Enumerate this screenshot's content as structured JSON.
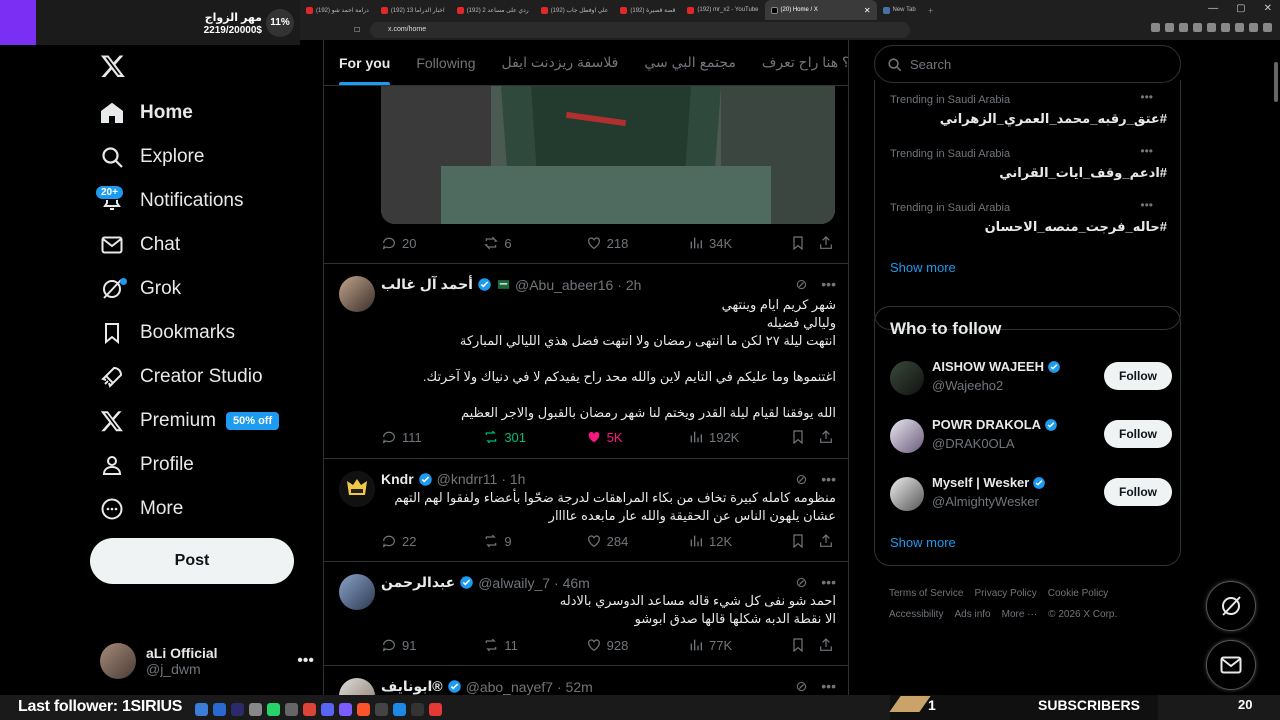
{
  "browser": {
    "tabs": [
      {
        "label": "(192) درامة احمد شو"
      },
      {
        "label": "(192) اخبار الدراما 13"
      },
      {
        "label": "(192) ردي على مساعد 2"
      },
      {
        "label": "(192) علي اوفطل جاب"
      },
      {
        "label": "(192) قصة قصيرة"
      },
      {
        "label": "(192) mr_x2 - YouTube"
      },
      {
        "label": "(20) Home / X"
      },
      {
        "label": "New Tab"
      }
    ],
    "url": "x.com/home"
  },
  "overlay": {
    "goal_title": "مهر الزواج",
    "goal_progress": "2219/20000$",
    "goal_percent": "11%",
    "last_follower": "Last follower: 1SIRIUS",
    "subscribers_count": "1",
    "subscribers_label": "SUBSCRIBERS",
    "corner_number": "20"
  },
  "sidebar": {
    "items": [
      {
        "label": "Home",
        "icon": "home-icon"
      },
      {
        "label": "Explore",
        "icon": "search-icon"
      },
      {
        "label": "Notifications",
        "icon": "bell-icon"
      },
      {
        "label": "Chat",
        "icon": "mail-icon"
      },
      {
        "label": "Grok",
        "icon": "grok-icon"
      },
      {
        "label": "Bookmarks",
        "icon": "bookmark-icon"
      },
      {
        "label": "Creator Studio",
        "icon": "rocket-icon"
      },
      {
        "label": "Premium",
        "icon": "x-icon"
      },
      {
        "label": "Profile",
        "icon": "person-icon"
      },
      {
        "label": "More",
        "icon": "more-circle-icon"
      }
    ],
    "notifications_badge": "20+",
    "premium_badge": "50% off",
    "post_label": "Post",
    "account_name": "aLi Official",
    "account_handle": "@j_dwm"
  },
  "feed": {
    "tabs": [
      "For you",
      "Following",
      "فلاسفة ريزدنت ايفل",
      "مجتمع البي سي",
      "فضل ؟ هنا راح تعرف"
    ],
    "first_actions": {
      "replies": "20",
      "reposts": "6",
      "likes": "218",
      "views": "34K"
    },
    "tweets": [
      {
        "name": "أحمد آل غالب",
        "handle": "@Abu_abeer16",
        "time": "· 2h",
        "text": "شهر كريم ايام وينتهي\nوليالي فضيله\nانتهت ليلة ٢٧ لكن ما انتهى رمضان ولا انتهت فضل هذي الليالي المباركة\n\nاغتنموها وما عليكم في التايم لاين والله محد راح يفيدكم لا في دنياك ولا آخرتك.\n\nالله يوفقنا لقيام ليلة القدر ويختم لنا شهر رمضان بالقبول والاجر العظيم",
        "replies": "111",
        "reposts": "301",
        "likes": "5K",
        "views": "192K"
      },
      {
        "name": "Kndr",
        "handle": "@kndrr11",
        "time": "· 1h",
        "text": "منظومه كامله كبيرة تخاف من بكاء المراهقات لدرجة ضحّوا بأعضاء ولفقوا لهم التهم\nعشان يلهون الناس عن الحقيقة والله عار مابعده عاااار",
        "replies": "22",
        "reposts": "9",
        "likes": "284",
        "views": "12K"
      },
      {
        "name": "عبدالرحمن",
        "handle": "@alwaily_7",
        "time": "· 46m",
        "text": "احمد شو نفى كل شيء قاله مساعد الدوسري بالادله\nالا نقطة الدبه شكلها قالها صدق ابوشو",
        "replies": "91",
        "reposts": "11",
        "likes": "928",
        "views": "77K"
      },
      {
        "name": "ابونايف®",
        "handle": "@abo_nayef7",
        "time": "· 52m",
        "text": ""
      }
    ]
  },
  "right": {
    "search_placeholder": "Search",
    "trends": [
      {
        "context": "Trending in Saudi Arabia",
        "tag": "#عتق_رقبه_محمد_العمري_الزهراني"
      },
      {
        "context": "Trending in Saudi Arabia",
        "tag": "#ادعم_وقف_ايات_القراني"
      },
      {
        "context": "Trending in Saudi Arabia",
        "tag": "#حاله_فرجت_منصه_الاحسان"
      }
    ],
    "show_more": "Show more",
    "who_to_follow_title": "Who to follow",
    "who": [
      {
        "name": "AISHOW WAJEEH",
        "handle": "@Wajeeho2"
      },
      {
        "name": "POWR DRAKOLA",
        "handle": "@DRAK0OLA"
      },
      {
        "name": "Myself | Wesker",
        "handle": "@AlmightyWesker"
      }
    ],
    "follow_label": "Follow",
    "show_more_2": "Show more",
    "footer": [
      "Terms of Service",
      "Privacy Policy",
      "Cookie Policy",
      "Accessibility",
      "Ads info",
      "More ···",
      "© 2026 X Corp."
    ]
  },
  "colors": {
    "accent": "#1d9bf0",
    "like_active": "#f91880",
    "repost_active": "#00ba7c",
    "goal_bar": "#7b2ff2"
  }
}
